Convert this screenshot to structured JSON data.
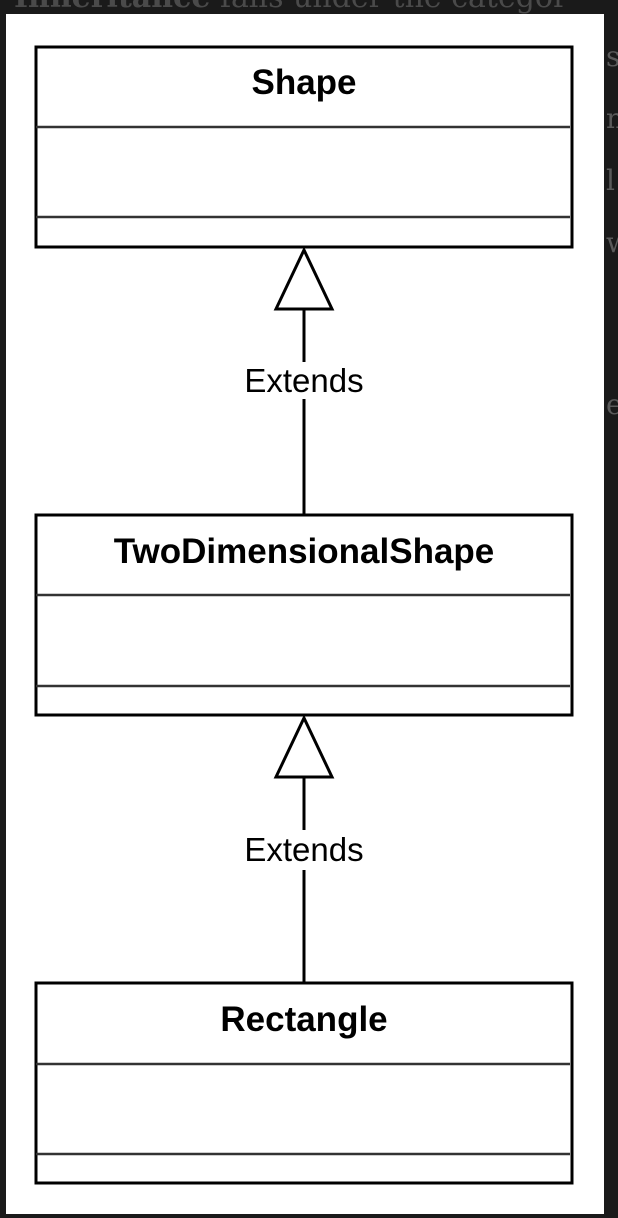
{
  "background": {
    "heading_bold": "Inheritance",
    "heading_rest": " falls under the categor",
    "fragments": [
      "s)",
      "n",
      "l",
      "w",
      "e"
    ]
  },
  "diagram": {
    "type": "uml-class-inheritance",
    "classes": [
      {
        "name": "Shape"
      },
      {
        "name": "TwoDimensionalShape"
      },
      {
        "name": "Rectangle"
      }
    ],
    "relations": [
      {
        "from": "TwoDimensionalShape",
        "to": "Shape",
        "label": "Extends"
      },
      {
        "from": "Rectangle",
        "to": "TwoDimensionalShape",
        "label": "Extends"
      }
    ]
  }
}
